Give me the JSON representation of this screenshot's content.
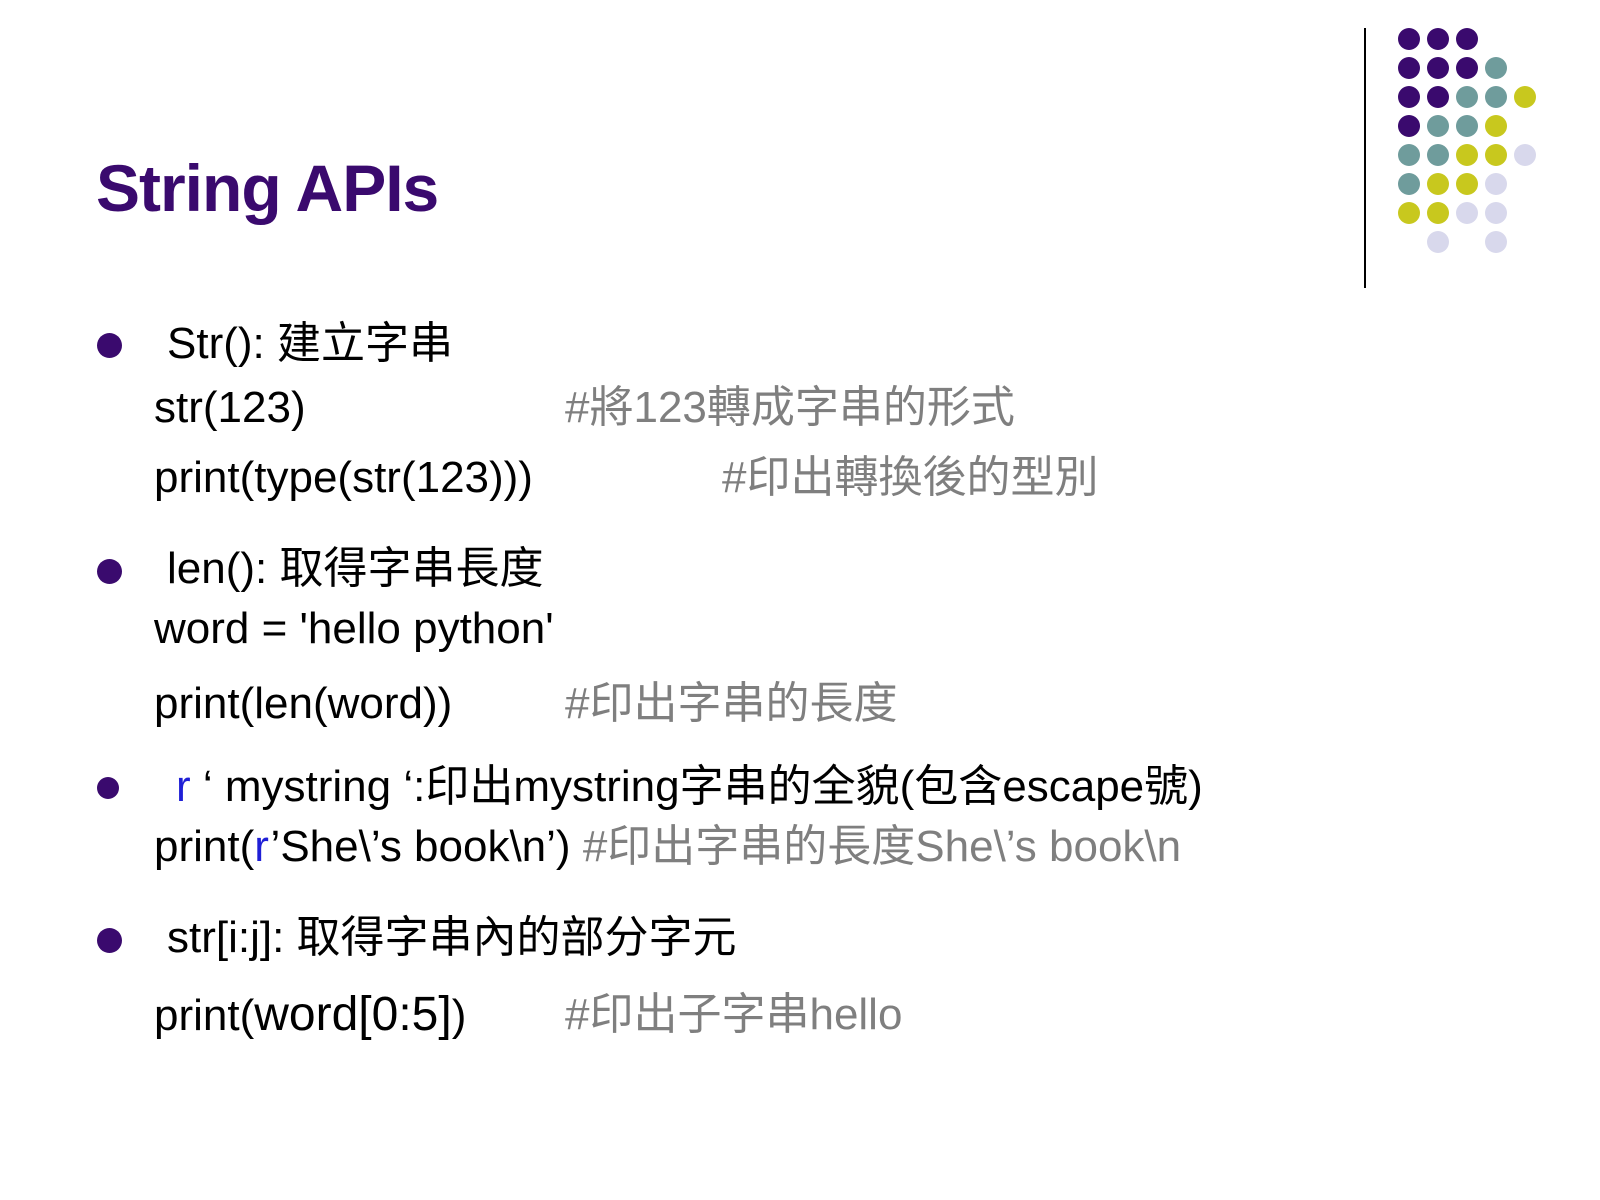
{
  "title": "String APIs",
  "colors": {
    "title": "#3a0a6e",
    "bullet": "#3a0a6e",
    "comment": "#7f7f7f",
    "raw_prefix": "#1f1fd6",
    "dot_purple": "#3a0a6e",
    "dot_teal": "#6f9c9c",
    "dot_yellow": "#c8c81e",
    "dot_lavender": "#d8d8ec"
  },
  "dots_decoration": [
    [
      "purple",
      "purple",
      "purple",
      "",
      "",
      ""
    ],
    [
      "purple",
      "purple",
      "purple",
      "teal",
      "",
      ""
    ],
    [
      "purple",
      "purple",
      "teal",
      "teal",
      "yellow",
      ""
    ],
    [
      "purple",
      "teal",
      "teal",
      "yellow",
      "",
      ""
    ],
    [
      "teal",
      "teal",
      "yellow",
      "yellow",
      "lavender",
      ""
    ],
    [
      "teal",
      "yellow",
      "yellow",
      "lavender",
      "",
      ""
    ],
    [
      "yellow",
      "yellow",
      "lavender",
      "lavender",
      "",
      ""
    ],
    [
      "",
      "lavender",
      "",
      "lavender",
      "",
      ""
    ]
  ],
  "sections": [
    {
      "heading": "Str(): 建立字串",
      "lines": [
        {
          "code": "str(123)",
          "comment": "#將123轉成字串的形式"
        },
        {
          "code": "print(type(str(123)))",
          "comment": "#印出轉換後的型別"
        }
      ]
    },
    {
      "heading": "len(): 取得字串長度",
      "lines": [
        {
          "code": "word = 'hello python'",
          "comment": ""
        },
        {
          "code": "print(len(word))",
          "comment": "#印出字串的長度"
        }
      ]
    },
    {
      "heading_prefix": "r",
      "heading_rest": " ‘ mystring ‘:印出mystring字串的全貌(包含escape號)",
      "lines": [
        {
          "code_a": "print(",
          "code_r": "r",
          "code_b": "’She\\’s book\\n’)",
          "comment": "#印出字串的長度She\\’s book\\n"
        }
      ]
    },
    {
      "heading": "str[i:j]: 取得字串內的部分字元",
      "lines": [
        {
          "code_a": "print(",
          "code_b": "word[0:5]",
          "code_c": ")",
          "comment": "#印出子字串hello"
        }
      ]
    }
  ]
}
